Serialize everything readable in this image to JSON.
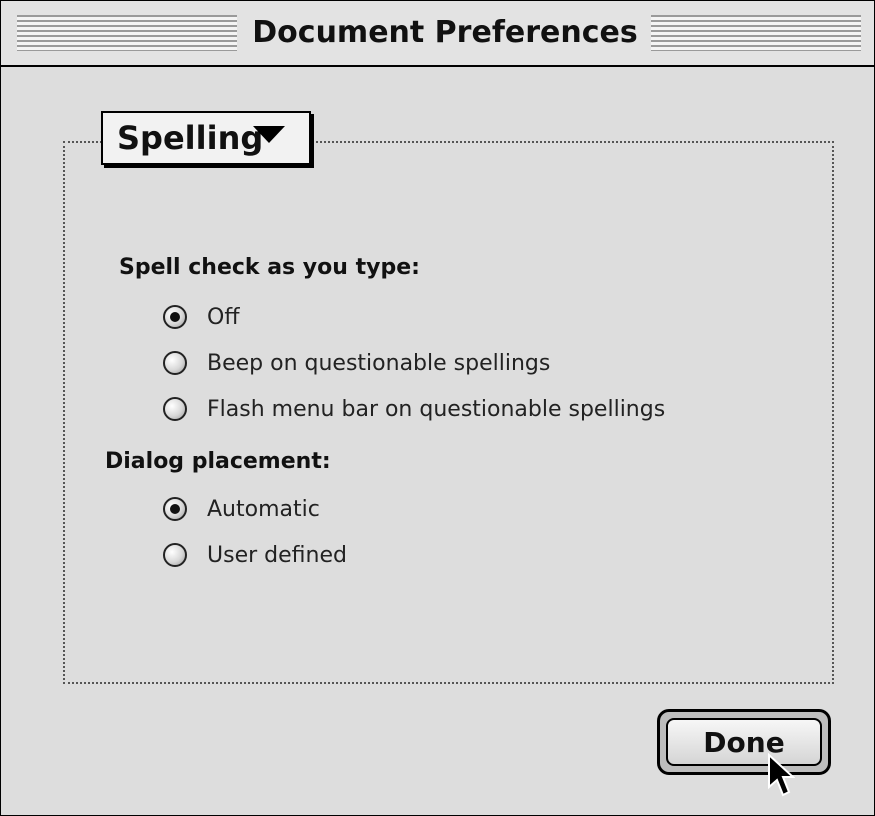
{
  "window": {
    "title": "Document Preferences"
  },
  "popup": {
    "selected": "Spelling"
  },
  "spell_check": {
    "heading": "Spell check as you type:",
    "options": [
      {
        "label": "Off",
        "checked": true
      },
      {
        "label": "Beep on questionable spellings",
        "checked": false
      },
      {
        "label": "Flash menu bar on questionable spellings",
        "checked": false
      }
    ]
  },
  "dialog_placement": {
    "heading": "Dialog placement:",
    "options": [
      {
        "label": "Automatic",
        "checked": true
      },
      {
        "label": "User defined",
        "checked": false
      }
    ]
  },
  "buttons": {
    "done": "Done"
  }
}
